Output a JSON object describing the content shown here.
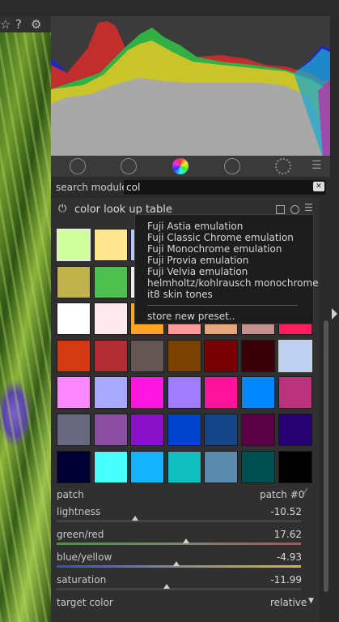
{
  "top_icons": {
    "star": "☆",
    "help": "?",
    "settings": "⚙"
  },
  "search": {
    "label": "search module",
    "value": "col"
  },
  "module": {
    "title": "color look up table"
  },
  "presets": {
    "items": [
      "Fuji Astia emulation",
      "Fuji Classic Chrome emulation",
      "Fuji Monochrome emulation",
      "Fuji Provia emulation",
      "Fuji Velvia emulation",
      "helmholtz/kohlrausch monochrome",
      "it8 skin tones"
    ],
    "store_label": "store new preset.."
  },
  "patches": [
    "#cfff9a",
    "#ffe58f",
    "#b8c7ff",
    "#c0c7f0",
    "#c7ffb0",
    "#ffc7a0",
    "#eec0c0",
    "#c2b24c",
    "#4fbf4f",
    "#eeeeee",
    "#cfcfcf",
    "#8ab0d0",
    "#e6a0c0",
    "#ff1f5a",
    "#ffffff",
    "#ffe8ee",
    "#ffa321",
    "#ff9a9a",
    "#e4a67a",
    "#c48f8f",
    "#ff1e5e",
    "#d33a11",
    "#b02e32",
    "#665555",
    "#7a4200",
    "#7a0008",
    "#3a0008",
    "#c0d0f0",
    "#ff88ff",
    "#a8a8ff",
    "#ff16e0",
    "#a07cff",
    "#ff139a",
    "#0088ff",
    "#b8337a",
    "#686880",
    "#8a4ea0",
    "#8b11c8",
    "#0044cc",
    "#154488",
    "#5a0044",
    "#240070",
    "#000033",
    "#4affff",
    "#16b4ff",
    "#10c0c0",
    "#5a8aae",
    "#004f50",
    "#000000"
  ],
  "patch": {
    "label": "patch",
    "value": "patch #0"
  },
  "sliders": [
    {
      "label": "lightness",
      "value": "-10.52",
      "level": 0.32
    },
    {
      "label": "green/red",
      "value": "17.62",
      "level": 0.53
    },
    {
      "label": "blue/yellow",
      "value": "-4.93",
      "level": 0.49
    },
    {
      "label": "saturation",
      "value": "-11.99",
      "level": 0.45
    }
  ],
  "target": {
    "label": "target color",
    "value": "relative"
  },
  "colors": {
    "panel_bg": "#303030",
    "accent": "#d0d0d0",
    "popup_bg": "#1d1d1d"
  }
}
